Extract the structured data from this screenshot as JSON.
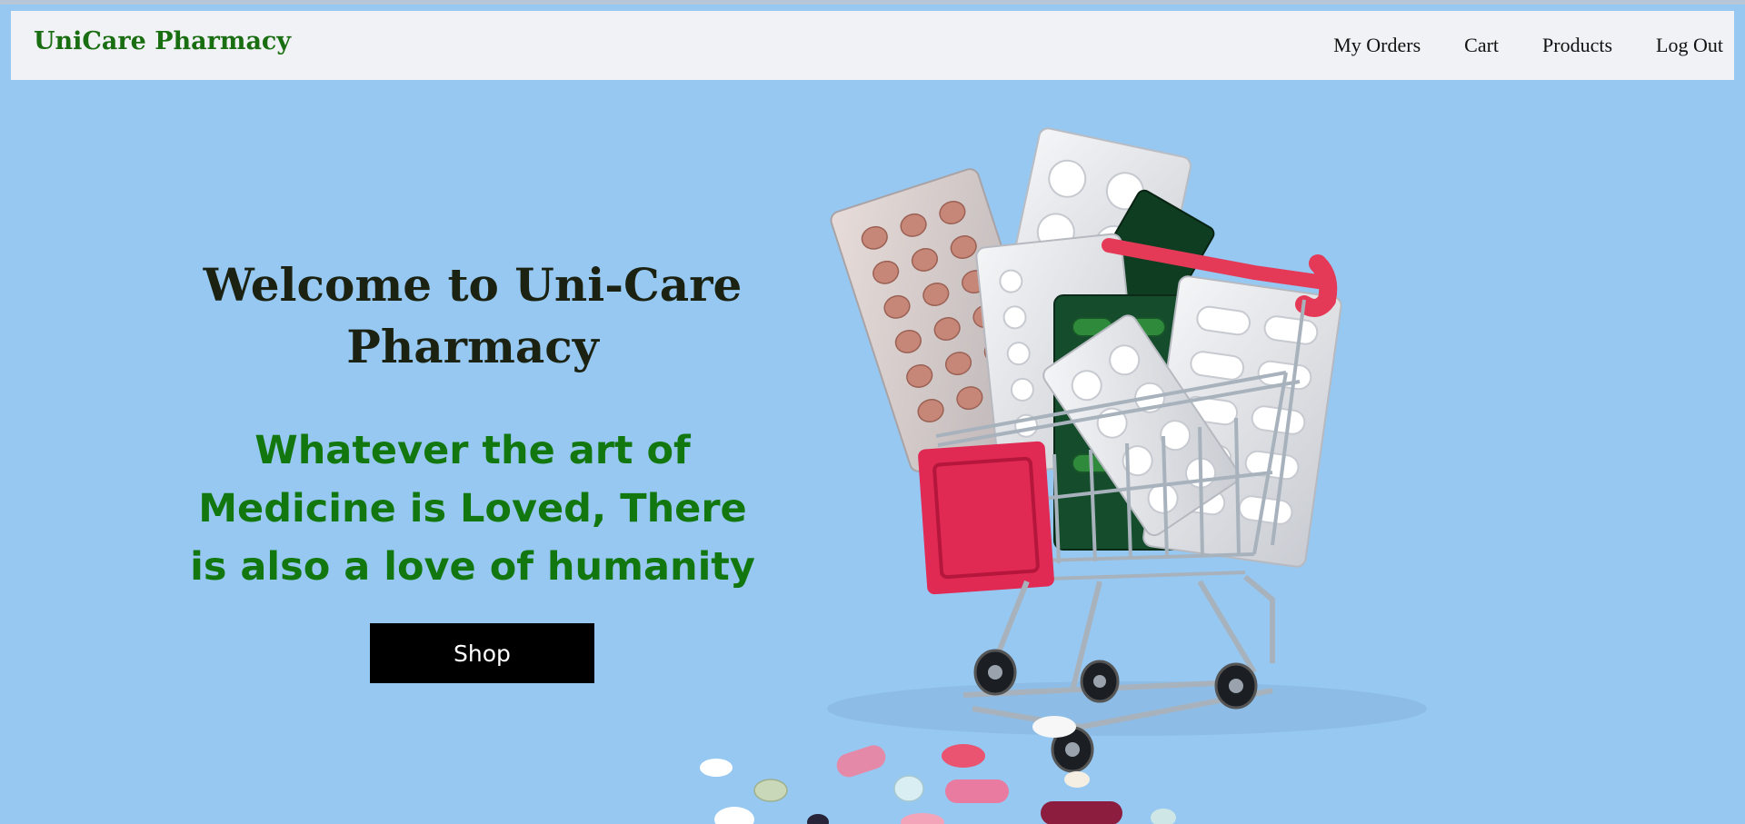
{
  "header": {
    "brand": "UniCare Pharmacy",
    "nav": [
      {
        "label": "My Orders"
      },
      {
        "label": "Cart"
      },
      {
        "label": "Products"
      },
      {
        "label": "Log Out"
      }
    ]
  },
  "hero": {
    "title": "Welcome to Uni-Care Pharmacy",
    "tagline": "Whatever the art of Medicine is Loved, There is also a love of humanity",
    "shop_label": "Shop",
    "image": "shopping-cart-with-pill-blister-packs"
  },
  "colors": {
    "page_background": "#96c8f2",
    "navbar_background": "#f1f2f5",
    "brand": "#1a6e12",
    "tagline": "#13770f",
    "title": "#1c2212",
    "button_background": "#000000"
  }
}
